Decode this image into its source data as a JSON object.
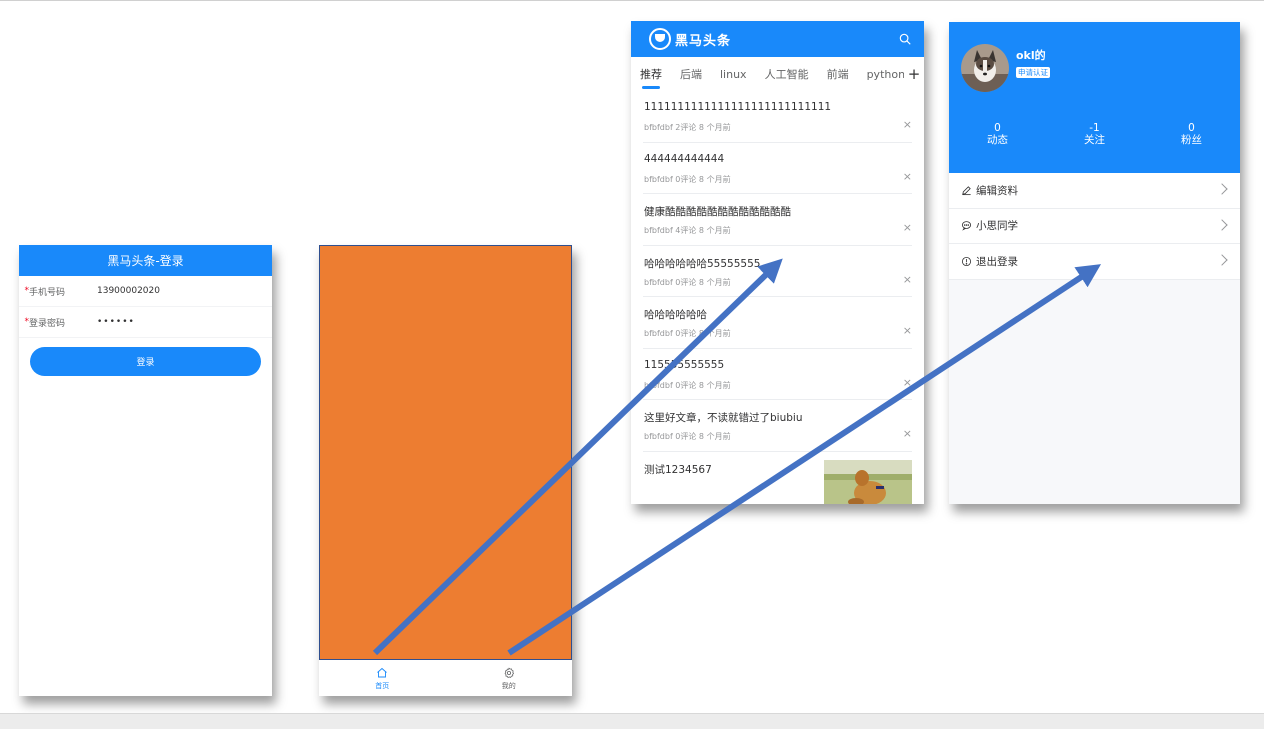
{
  "login": {
    "title": "黑马头条-登录",
    "phone_label": "手机号码",
    "phone_value": "13900002020",
    "password_label": "登录密码",
    "password_value": "••••••",
    "required_mark": "*",
    "login_button": "登录"
  },
  "layout": {
    "accent_color": "#ed7d31",
    "tabs": [
      {
        "label": "首页",
        "icon": "home-icon"
      },
      {
        "label": "我的",
        "icon": "gear-icon"
      }
    ]
  },
  "home": {
    "brand": "黑马头条",
    "channels": [
      "推荐",
      "后端",
      "linux",
      "人工智能",
      "前端",
      "python"
    ],
    "add_channel": "+",
    "articles": [
      {
        "title": "1111111111111111111111111111",
        "meta": "bfbfdbf 2评论 8 个月前"
      },
      {
        "title": "444444444444",
        "meta": "bfbfdbf 0评论 8 个月前"
      },
      {
        "title": "健康酷酷酷酷酷酷酷酷酷酷酷酷",
        "meta": "bfbfdbf 4评论 8 个月前"
      },
      {
        "title": "哈哈哈哈哈哈55555555",
        "meta": "bfbfdbf 0评论 8 个月前"
      },
      {
        "title": "哈哈哈哈哈哈",
        "meta": "bfbfdbf 0评论 8 个月前"
      },
      {
        "title": "115555555555",
        "meta": "bfbfdbf 0评论 8 个月前"
      },
      {
        "title": "这里好文章，不读就错过了biubiu",
        "meta": "bfbfdbf 0评论 8 个月前"
      },
      {
        "title": "测试1234567",
        "meta": ""
      }
    ],
    "close_glyph": "×"
  },
  "profile": {
    "name": "okl的",
    "apply_badge": "申请认证",
    "stats": [
      {
        "count": "0",
        "label": "动态"
      },
      {
        "count": "-1",
        "label": "关注"
      },
      {
        "count": "0",
        "label": "粉丝"
      }
    ],
    "menu": [
      {
        "label": "编辑资料",
        "icon": "edit-icon"
      },
      {
        "label": "小思同学",
        "icon": "chat-icon"
      },
      {
        "label": "退出登录",
        "icon": "info-icon"
      }
    ]
  },
  "colors": {
    "primary": "#1989fa",
    "arrow": "#4472c4",
    "orange": "#ed7d31"
  }
}
